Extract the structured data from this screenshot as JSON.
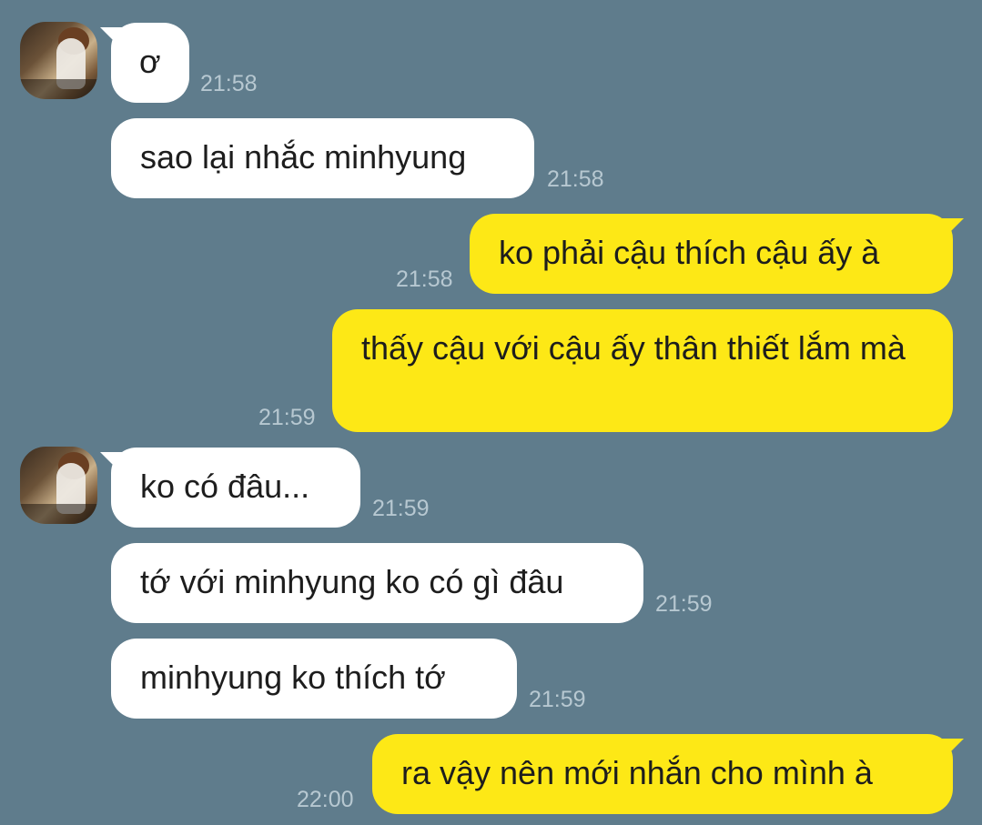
{
  "conversation": {
    "messages": [
      {
        "sender": "other",
        "text": "ơ",
        "time": "21:58"
      },
      {
        "sender": "other",
        "text": "sao lại nhắc minhyung",
        "time": "21:58"
      },
      {
        "sender": "me",
        "text": "ko phải cậu thích cậu ấy à",
        "time": "21:58"
      },
      {
        "sender": "me",
        "text": "thấy cậu với cậu ấy thân thiết lắm mà",
        "time": "21:59"
      },
      {
        "sender": "other",
        "text": "ko có đâu...",
        "time": "21:59"
      },
      {
        "sender": "other",
        "text": "tớ với minhyung ko có gì đâu",
        "time": "21:59"
      },
      {
        "sender": "other",
        "text": "minhyung ko thích tớ",
        "time": "21:59"
      },
      {
        "sender": "me",
        "text": "ra vậy nên mới nhắn cho mình à",
        "time": "22:00"
      }
    ]
  },
  "colors": {
    "background": "#5f7c8c",
    "incoming_bubble": "#ffffff",
    "outgoing_bubble": "#fde816",
    "timestamp": "#b7c8d1"
  }
}
